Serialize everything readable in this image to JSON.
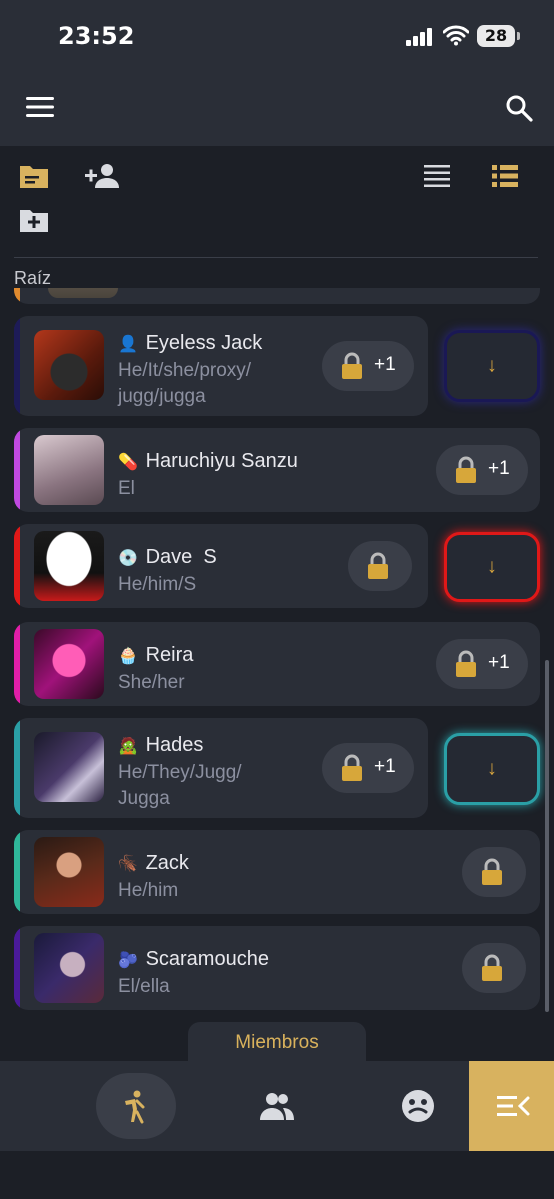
{
  "status": {
    "time": "23:52",
    "battery": "28"
  },
  "root_label": "Raíz",
  "members": [
    {
      "emoji": "👤",
      "name": "Eyeless Jack",
      "pronouns": "He/It/she/proxy/\njugg/jugga",
      "badge": "+1"
    },
    {
      "emoji": "💊",
      "name": "Haruchiyu Sanzu",
      "pronouns": "El",
      "badge": "+1"
    },
    {
      "emoji": "💿",
      "name": "Dave  S",
      "pronouns": "He/him/S",
      "badge": ""
    },
    {
      "emoji": "🧁",
      "name": "Reira",
      "pronouns": "She/her",
      "badge": "+1"
    },
    {
      "emoji": "🧟",
      "name": "Hades",
      "pronouns": "He/They/Jugg/\nJugga",
      "badge": "+1"
    },
    {
      "emoji": "🪳",
      "name": "Zack",
      "pronouns": "He/him",
      "badge": ""
    },
    {
      "emoji": "🫐",
      "name": "Scaramouche",
      "pronouns": "El/ella",
      "badge": ""
    }
  ],
  "side_buttons": {
    "arrow": "↓"
  },
  "bottom_tab": {
    "label": "Miembros"
  },
  "colors": {
    "accent": "#d9a63f",
    "eyeless_bar": "#1d1b57",
    "haruchiyu_bar": "#c049e0",
    "dave_bar": "#e01818",
    "reira_bar": "#e11ea8",
    "hades_bar": "#2a9fa6",
    "zack_bar": "#2fb79a",
    "scaramouche_bar": "#4a1a9a"
  }
}
